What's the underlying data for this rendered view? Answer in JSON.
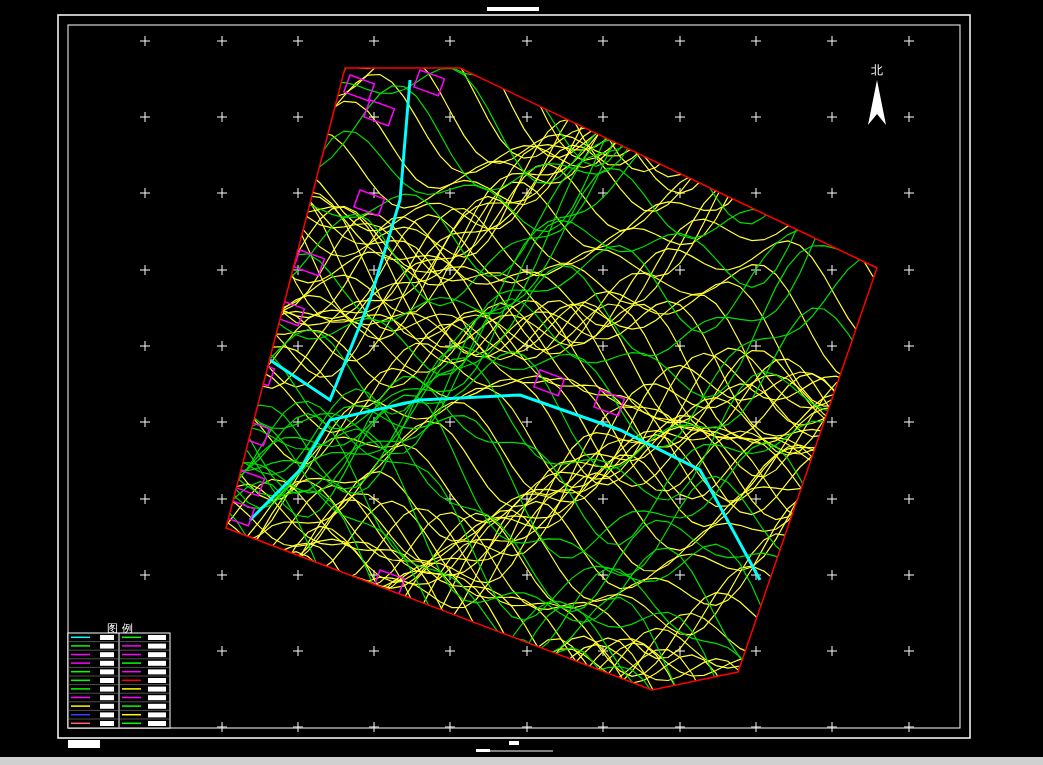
{
  "map": {
    "north_label": "北"
  },
  "legend": {
    "title": "图 例"
  }
}
